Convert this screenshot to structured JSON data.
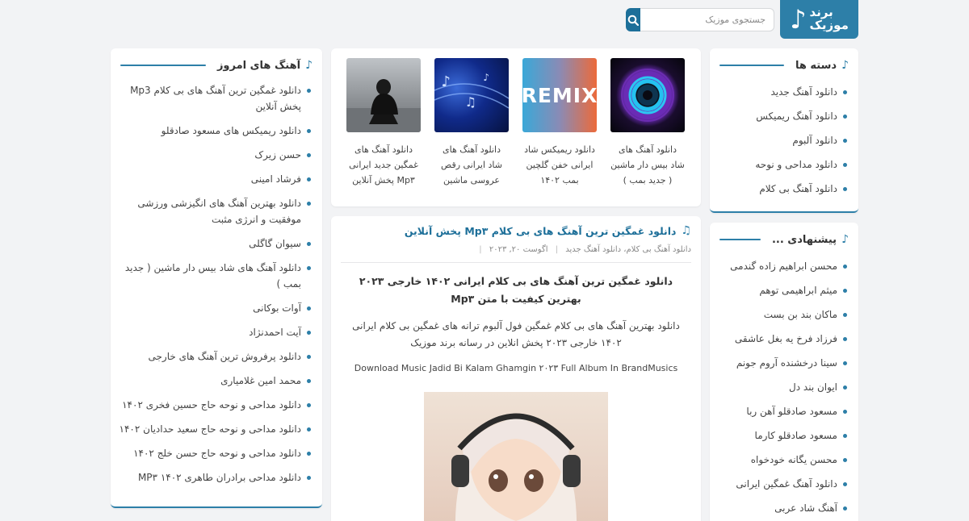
{
  "header": {
    "logo_line1": "برند",
    "logo_line2": "موزیک",
    "search_placeholder": "جستجوی موزیک"
  },
  "categories": {
    "title": "دسته ها",
    "items": [
      "دانلود آهنگ جدید",
      "دانلود آهنگ ریمیکس",
      "دانلود آلبوم",
      "دانلود مداحی و نوحه",
      "دانلود آهنگ بی کلام"
    ]
  },
  "suggested": {
    "title": "پیشنهادی ...",
    "items": [
      "محسن ابراهیم زاده گندمی",
      "میثم ابراهیمی توهم",
      "ماکان بند بن بست",
      "فرزاد فرخ یه بغل عاشقی",
      "سینا درخشنده آروم جونم",
      "ایوان بند دل",
      "مسعود صادقلو آهن ربا",
      "مسعود صادقلو کارما",
      "محسن یگانه خودخواه",
      "دانلود آهنگ غمگین ایرانی",
      "آهنگ شاد عربی"
    ]
  },
  "today_songs": {
    "title": "آهنگ های امروز",
    "items": [
      "دانلود غمگین ترین آهنگ های بی کلام Mp3 پخش آنلاین",
      "دانلود ریمیکس های مسعود صادقلو",
      "حسن زیرک",
      "فرشاد امینی",
      "دانلود بهترین آهنگ های انگیزشی ورزشی موفقیت و انرژی مثبت",
      "سیوان گاگلی",
      "دانلود آهنگ های شاد بیس دار ماشین ( جدید بمب )",
      "آوات بوکانی",
      "آیت احمدنژاد",
      "دانلود پرفروش ترین آهنگ های خارجی",
      "محمد امین غلامیاری",
      "دانلود مداحی و نوحه حاج حسین فخری ۱۴۰۲",
      "دانلود مداحی و نوحه حاج سعید حدادیان ۱۴۰۲",
      "دانلود مداحی و نوحه حاج حسن خلج ۱۴۰۲",
      "دانلود مداحی برادران طاهری ۱۴۰۲ MP۳"
    ]
  },
  "top_songs": [
    {
      "title": "دانلود آهنگ های شاد بیس دار ماشین ( جدید بمب )"
    },
    {
      "title": "دانلود ریمیکس شاد ایرانی خفن گلچین بمب ۱۴۰۲",
      "thumb_text": "REMIX"
    },
    {
      "title": "دانلود آهنگ های شاد ایرانی رقص عروسی ماشین"
    },
    {
      "title": "دانلود آهنگ های غمگین جدید ایرانی Mp۳ پخش آنلاین"
    }
  ],
  "post": {
    "title": "دانلود غمگین ترین آهنگ های بی کلام Mp۳ پخش آنلاین",
    "meta_categories": "دانلود آهنگ بی کلام، دانلود آهنگ جدید",
    "meta_date": "اگوست ۲۰, ۲۰۲۳",
    "heading": "دانلود غمگین ترین آهنگ های بی کلام ایرانی ۱۴۰۲ خارجی ۲۰۲۳ بهترین کیفیت با متن Mp۳",
    "description": "دانلود بهترین آهنگ های بی کلام غمگین  فول آلبوم ترانه های غمگین بی کلام ایرانی ۱۴۰۲ خارجی ۲۰۲۳ پخش انلاین در رسانه برند موزیک",
    "english_line": "Download Music Jadid Bi Kalam Ghamgin ۲۰۲۳  Full Album In BrandMusics"
  },
  "colors": {
    "accent": "#2d7fa8",
    "search_button": "#1d6f99",
    "background": "#f2f3f5"
  }
}
